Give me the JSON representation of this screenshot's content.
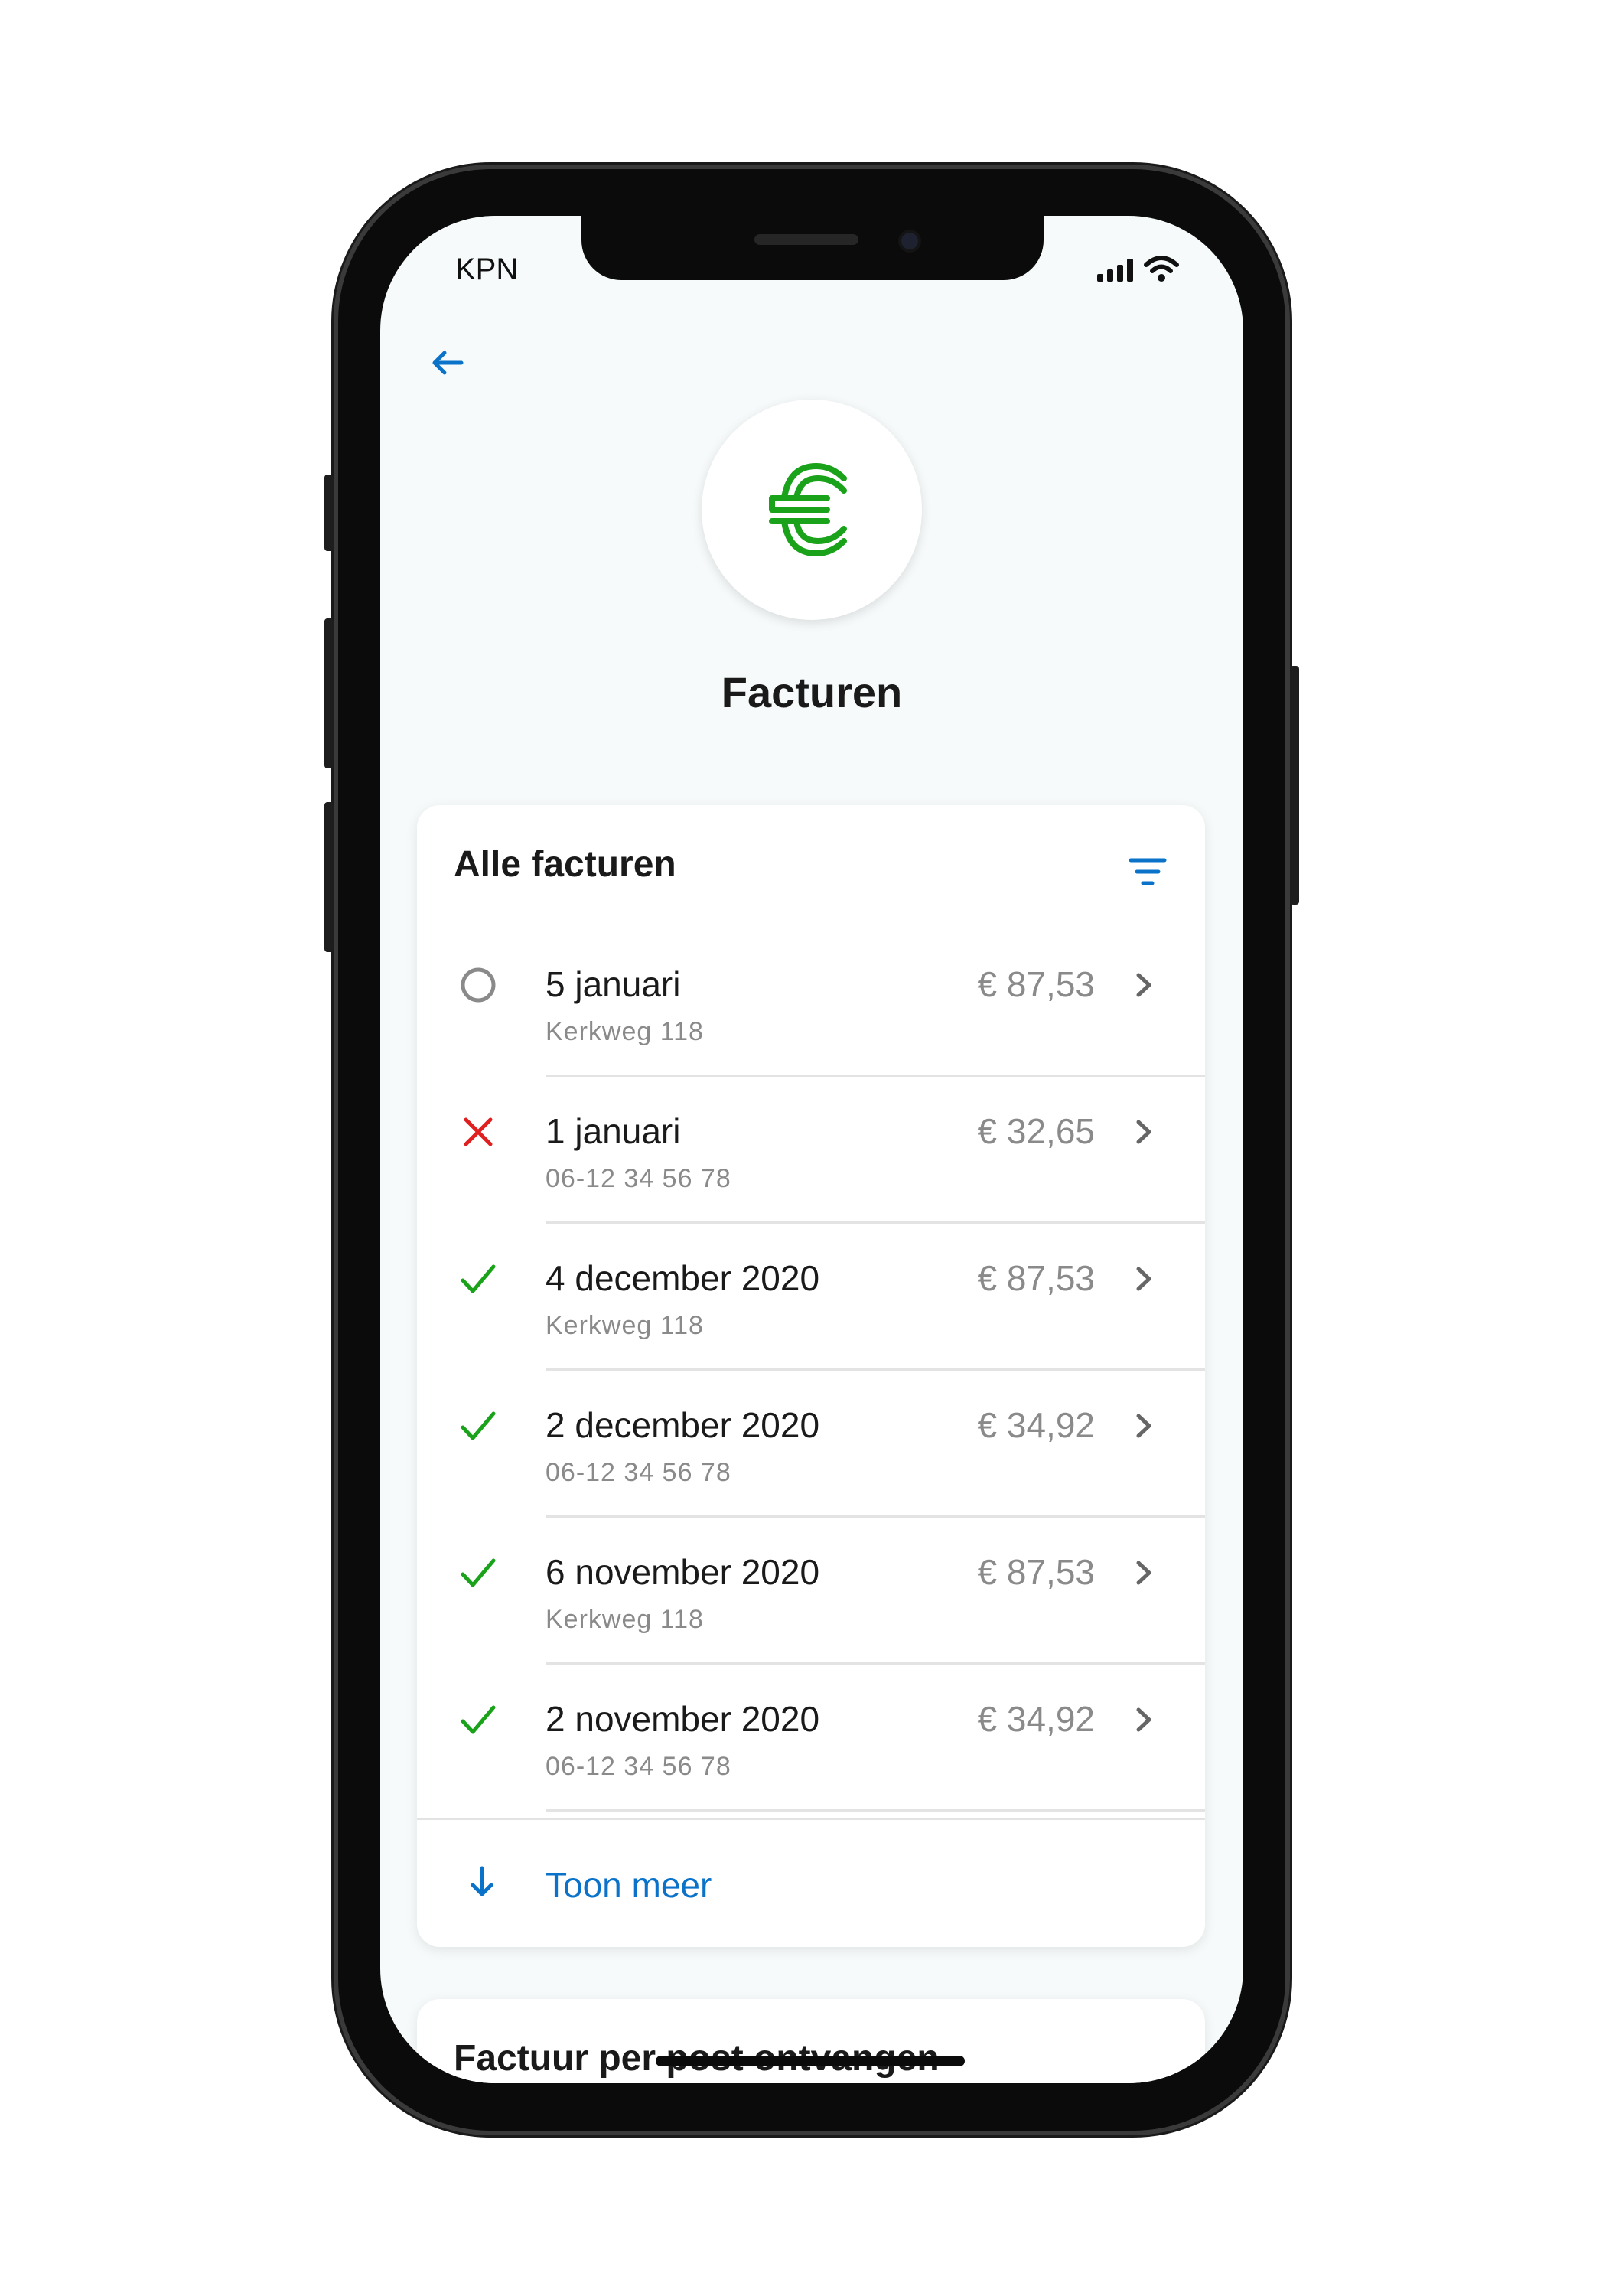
{
  "status_bar": {
    "carrier": "KPN"
  },
  "header": {
    "title": "Facturen",
    "hero_icon": "euro-icon",
    "accent_color": "#0a72c9",
    "hero_color": "#1aa21a"
  },
  "invoices_card": {
    "title": "Alle facturen",
    "items": [
      {
        "title": "5 januari",
        "subtitle": "Kerkweg 118",
        "amount": "€ 87,53",
        "status": "open"
      },
      {
        "title": "1 januari",
        "subtitle": "06-12 34 56 78",
        "amount": "€ 32,65",
        "status": "failed"
      },
      {
        "title": "4 december 2020",
        "subtitle": "Kerkweg 118",
        "amount": "€ 87,53",
        "status": "paid"
      },
      {
        "title": "2 december 2020",
        "subtitle": "06-12 34 56 78",
        "amount": "€ 34,92",
        "status": "paid"
      },
      {
        "title": "6 november 2020",
        "subtitle": "Kerkweg 118",
        "amount": "€ 87,53",
        "status": "paid"
      },
      {
        "title": "2 november 2020",
        "subtitle": "06-12 34 56 78",
        "amount": "€ 34,92",
        "status": "paid"
      }
    ],
    "more_label": "Toon meer"
  },
  "second_card": {
    "title": "Factuur per post ontvangen"
  },
  "status_colors": {
    "paid": "#1aa21a",
    "failed": "#e02020",
    "open": "#8a8a8a"
  }
}
